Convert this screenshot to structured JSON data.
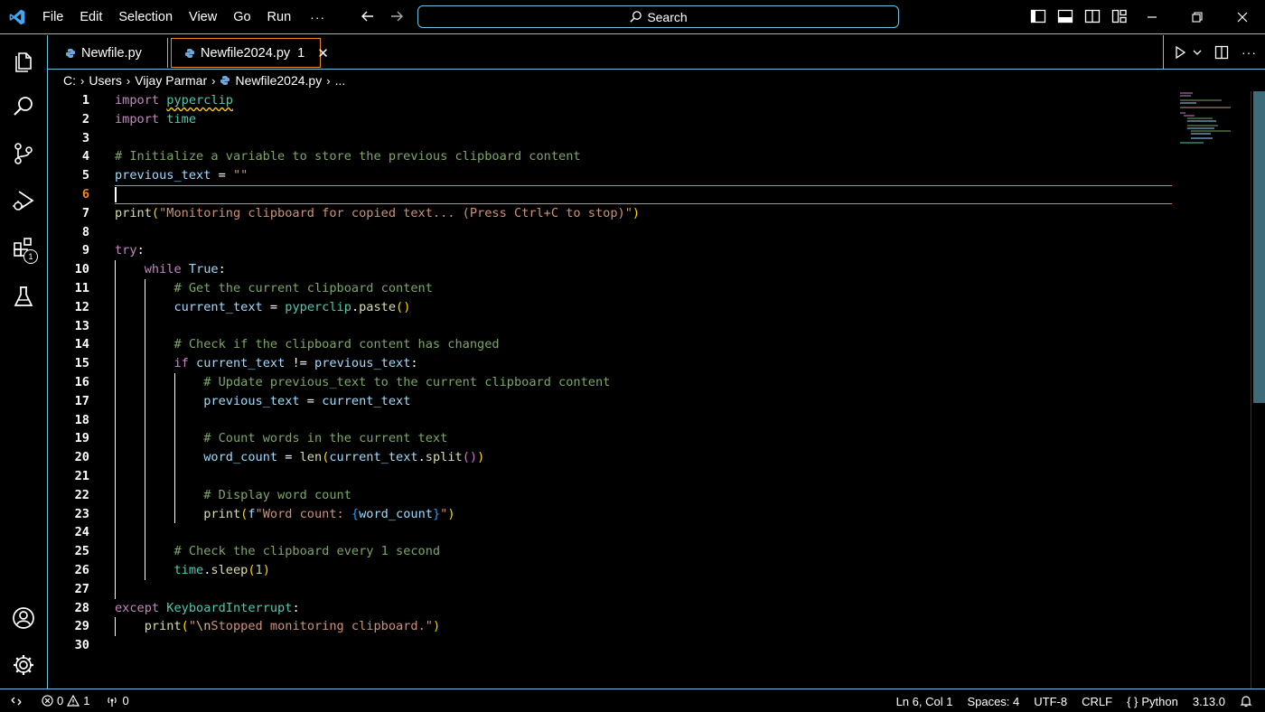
{
  "menu": {
    "items": [
      "File",
      "Edit",
      "Selection",
      "View",
      "Go",
      "Run"
    ],
    "more": "···"
  },
  "search": {
    "label": "Search"
  },
  "tabs": [
    {
      "label": "Newfile.py",
      "active": false
    },
    {
      "label": "Newfile2024.py",
      "problems": "1",
      "close": "✕",
      "active": true
    }
  ],
  "breadcrumb": [
    "C:",
    "Users",
    "Vijay Parmar",
    "Newfile2024.py",
    "..."
  ],
  "activity": {
    "extensions_badge": "1"
  },
  "editor": {
    "current_line": 6,
    "line_numbers": [
      "1",
      "2",
      "3",
      "4",
      "5",
      "6",
      "7",
      "8",
      "9",
      "10",
      "11",
      "12",
      "13",
      "14",
      "15",
      "16",
      "17",
      "18",
      "19",
      "20",
      "21",
      "22",
      "23",
      "24",
      "25",
      "26",
      "27",
      "28",
      "29",
      "30"
    ],
    "code": [
      [
        [
          "kw",
          "import"
        ],
        [
          "op",
          " "
        ],
        [
          "ty warn",
          "pyperclip"
        ]
      ],
      [
        [
          "kw",
          "import"
        ],
        [
          "op",
          " "
        ],
        [
          "ty",
          "time"
        ]
      ],
      [],
      [
        [
          "cm",
          "# Initialize a variable to store the previous clipboard content"
        ]
      ],
      [
        [
          "vr",
          "previous_text"
        ],
        [
          "op",
          " = "
        ],
        [
          "st",
          "\"\""
        ]
      ],
      [],
      [
        [
          "fn",
          "print"
        ],
        [
          "p1",
          "("
        ],
        [
          "st",
          "\"Monitoring clipboard for copied text... (Press Ctrl+C to stop)\""
        ],
        [
          "p1",
          ")"
        ]
      ],
      [],
      [
        [
          "kw",
          "try"
        ],
        [
          "op",
          ":"
        ]
      ],
      [
        [
          "op",
          "    "
        ],
        [
          "kw",
          "while"
        ],
        [
          "op",
          " "
        ],
        [
          "vr",
          "True"
        ],
        [
          "op",
          ":"
        ]
      ],
      [
        [
          "op",
          "        "
        ],
        [
          "cm",
          "# Get the current clipboard content"
        ]
      ],
      [
        [
          "op",
          "        "
        ],
        [
          "vr",
          "current_text"
        ],
        [
          "op",
          " = "
        ],
        [
          "ty",
          "pyperclip"
        ],
        [
          "op",
          "."
        ],
        [
          "fn",
          "paste"
        ],
        [
          "p1",
          "()"
        ]
      ],
      [],
      [
        [
          "op",
          "        "
        ],
        [
          "cm",
          "# Check if the clipboard content has changed"
        ]
      ],
      [
        [
          "op",
          "        "
        ],
        [
          "kw",
          "if"
        ],
        [
          "op",
          " "
        ],
        [
          "vr",
          "current_text"
        ],
        [
          "op",
          " != "
        ],
        [
          "vr",
          "previous_text"
        ],
        [
          "op",
          ":"
        ]
      ],
      [
        [
          "op",
          "            "
        ],
        [
          "cm",
          "# Update previous_text to the current clipboard content"
        ]
      ],
      [
        [
          "op",
          "            "
        ],
        [
          "vr",
          "previous_text"
        ],
        [
          "op",
          " = "
        ],
        [
          "vr",
          "current_text"
        ]
      ],
      [],
      [
        [
          "op",
          "            "
        ],
        [
          "cm",
          "# Count words in the current text"
        ]
      ],
      [
        [
          "op",
          "            "
        ],
        [
          "vr",
          "word_count"
        ],
        [
          "op",
          " = "
        ],
        [
          "fn",
          "len"
        ],
        [
          "p1",
          "("
        ],
        [
          "vr",
          "current_text"
        ],
        [
          "op",
          "."
        ],
        [
          "fn",
          "split"
        ],
        [
          "p2",
          "()"
        ],
        [
          "p1",
          ")"
        ]
      ],
      [],
      [
        [
          "op",
          "            "
        ],
        [
          "cm",
          "# Display word count"
        ]
      ],
      [
        [
          "op",
          "            "
        ],
        [
          "fn",
          "print"
        ],
        [
          "p1",
          "("
        ],
        [
          "vr",
          "f"
        ],
        [
          "st",
          "\"Word count: "
        ],
        [
          "p3",
          "{"
        ],
        [
          "vr",
          "word_count"
        ],
        [
          "p3",
          "}"
        ],
        [
          "st",
          "\""
        ],
        [
          "p1",
          ")"
        ]
      ],
      [],
      [
        [
          "op",
          "        "
        ],
        [
          "cm",
          "# Check the clipboard every 1 second"
        ]
      ],
      [
        [
          "op",
          "        "
        ],
        [
          "ty",
          "time"
        ],
        [
          "op",
          "."
        ],
        [
          "fn",
          "sleep"
        ],
        [
          "p1",
          "("
        ],
        [
          "nm",
          "1"
        ],
        [
          "p1",
          ")"
        ]
      ],
      [],
      [
        [
          "kw",
          "except"
        ],
        [
          "op",
          " "
        ],
        [
          "ty",
          "KeyboardInterrupt"
        ],
        [
          "op",
          ":"
        ]
      ],
      [
        [
          "op",
          "    "
        ],
        [
          "fn",
          "print"
        ],
        [
          "p1",
          "("
        ],
        [
          "st",
          "\""
        ],
        [
          "es",
          "\\n"
        ],
        [
          "st",
          "Stopped monitoring clipboard.\""
        ],
        [
          "p1",
          ")"
        ]
      ],
      []
    ]
  },
  "status": {
    "errors": "0",
    "warnings": "1",
    "ports": "0",
    "cursor": "Ln 6, Col 1",
    "spaces": "Spaces: 4",
    "encoding": "UTF-8",
    "eol": "CRLF",
    "language": "Python",
    "interpreter": "3.13.0"
  },
  "colors": {
    "accent": "#6fc3df",
    "active_tab_border": "#f38518",
    "keyword": "#c586c0",
    "type": "#4ec9b0",
    "function": "#dcdcaa",
    "variable": "#9cdcfe",
    "string": "#ce9178",
    "comment": "#7ca668"
  }
}
